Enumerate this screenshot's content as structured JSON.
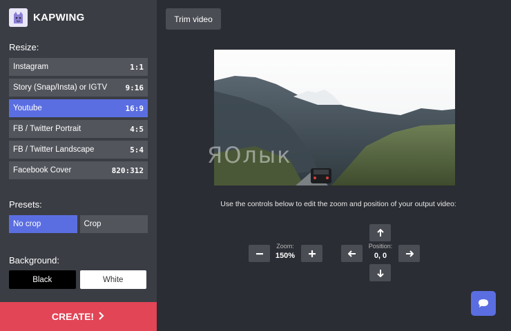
{
  "brand": {
    "name": "KAPWING"
  },
  "sidebar": {
    "resize_label": "Resize:",
    "resize_items": [
      {
        "label": "Instagram",
        "ratio": "1:1"
      },
      {
        "label": "Story (Snap/Insta) or IGTV",
        "ratio": "9:16"
      },
      {
        "label": "Youtube",
        "ratio": "16:9",
        "active": true
      },
      {
        "label": "FB / Twitter Portrait",
        "ratio": "4:5"
      },
      {
        "label": "FB / Twitter Landscape",
        "ratio": "5:4"
      },
      {
        "label": "Facebook Cover",
        "ratio": "820:312"
      }
    ],
    "presets_label": "Presets:",
    "presets": [
      {
        "label": "No crop",
        "active": true
      },
      {
        "label": "Crop"
      }
    ],
    "background_label": "Background:",
    "background_options": {
      "black": "Black",
      "white": "White"
    },
    "create_label": "CREATE!"
  },
  "toolbar": {
    "trim_label": "Trim video"
  },
  "preview": {
    "watermark": "ЯОлык"
  },
  "controls": {
    "hint": "Use the controls below to edit the zoom and position of your output video:",
    "zoom_label": "Zoom:",
    "zoom_value": "150%",
    "position_label": "Position:",
    "position_value": "0, 0"
  },
  "colors": {
    "accent": "#5b6ee1",
    "create": "#e24556",
    "sidebar": "#3a3d44",
    "main": "#2a2d33"
  }
}
